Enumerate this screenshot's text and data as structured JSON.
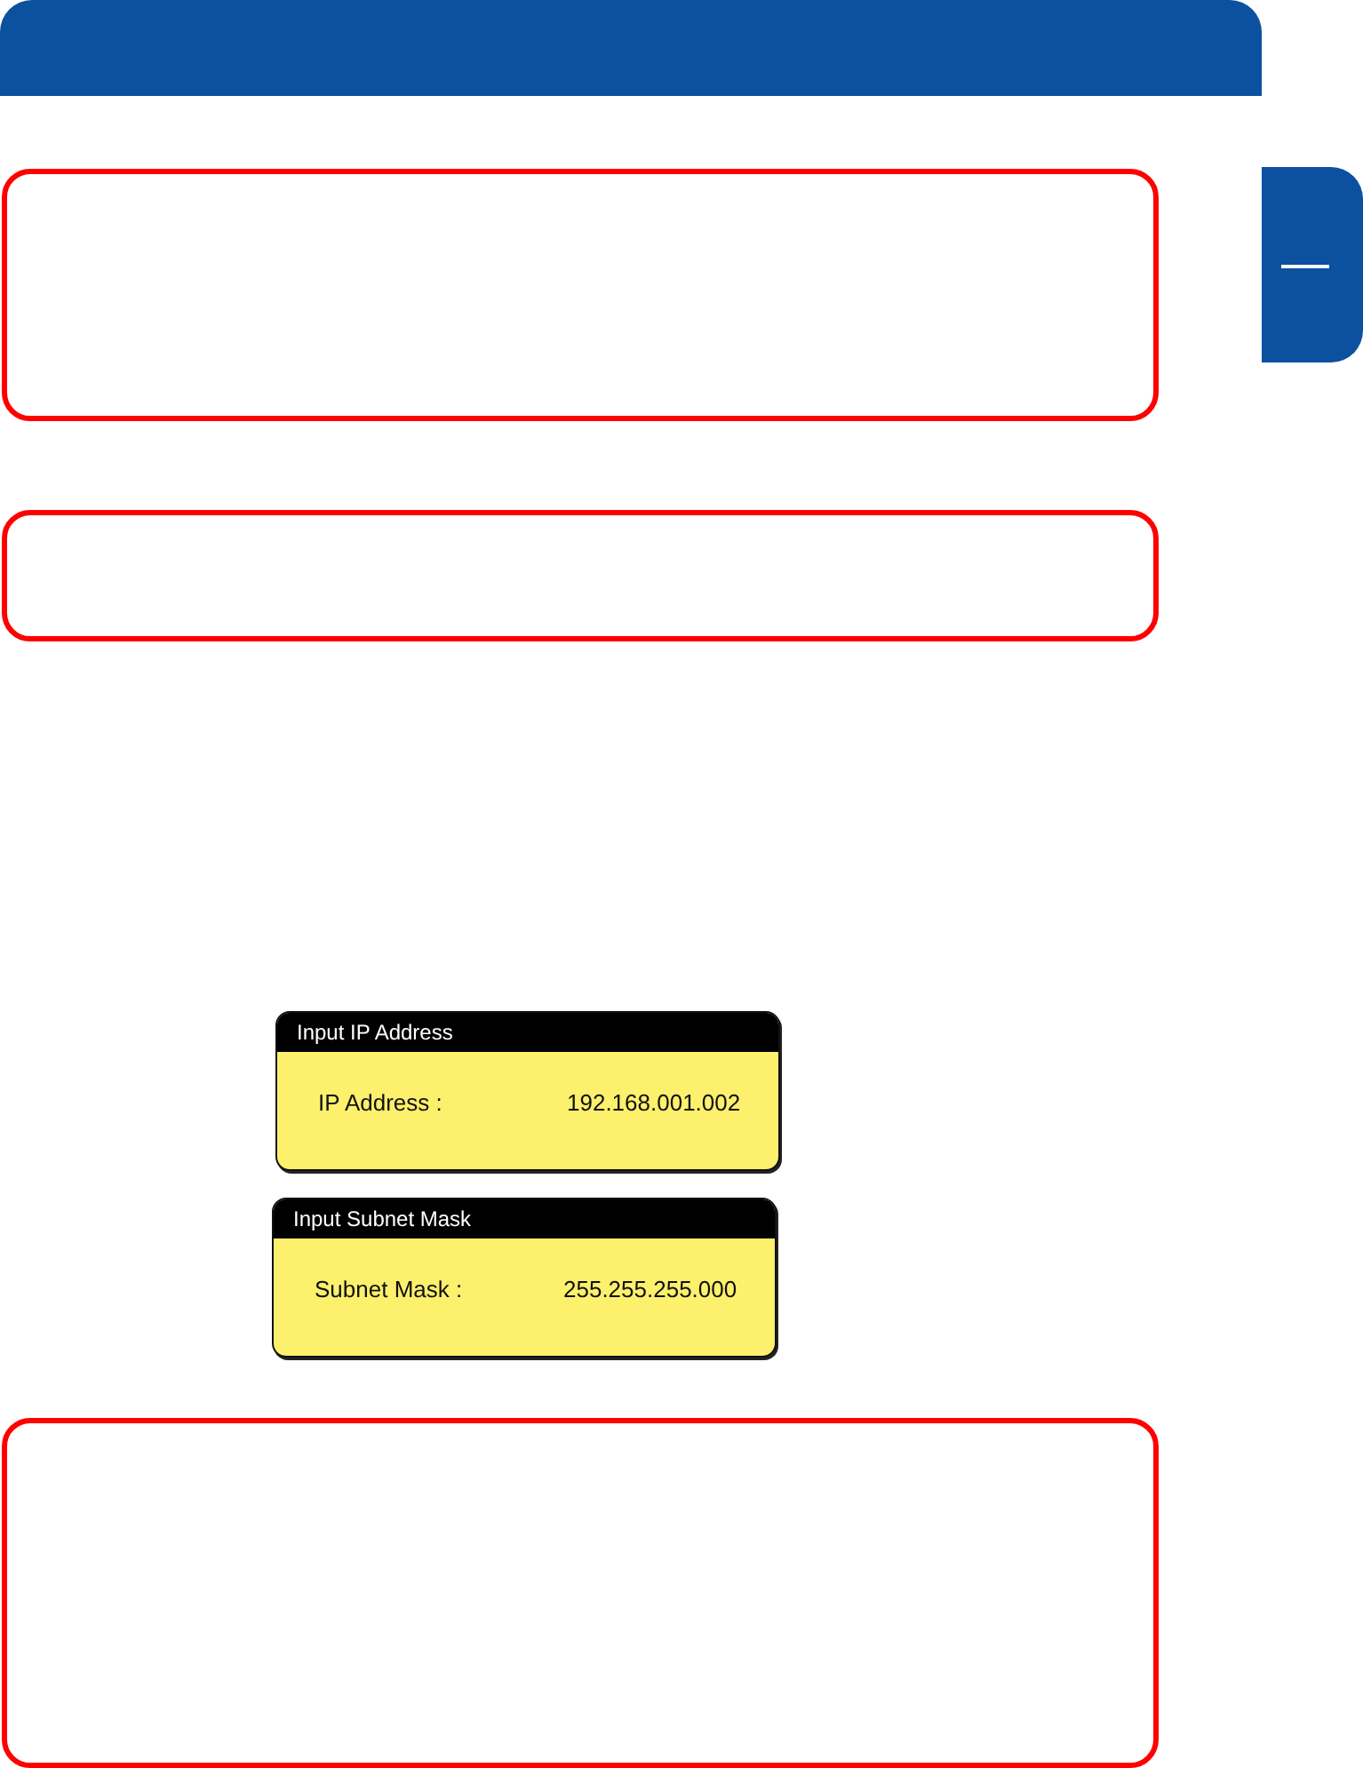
{
  "dialogs": [
    {
      "title": "Input IP Address",
      "label": "IP Address :",
      "value": "192.168.001.002"
    },
    {
      "title": "Input Subnet Mask",
      "label": "Subnet Mask :",
      "value": "255.255.255.000"
    }
  ]
}
